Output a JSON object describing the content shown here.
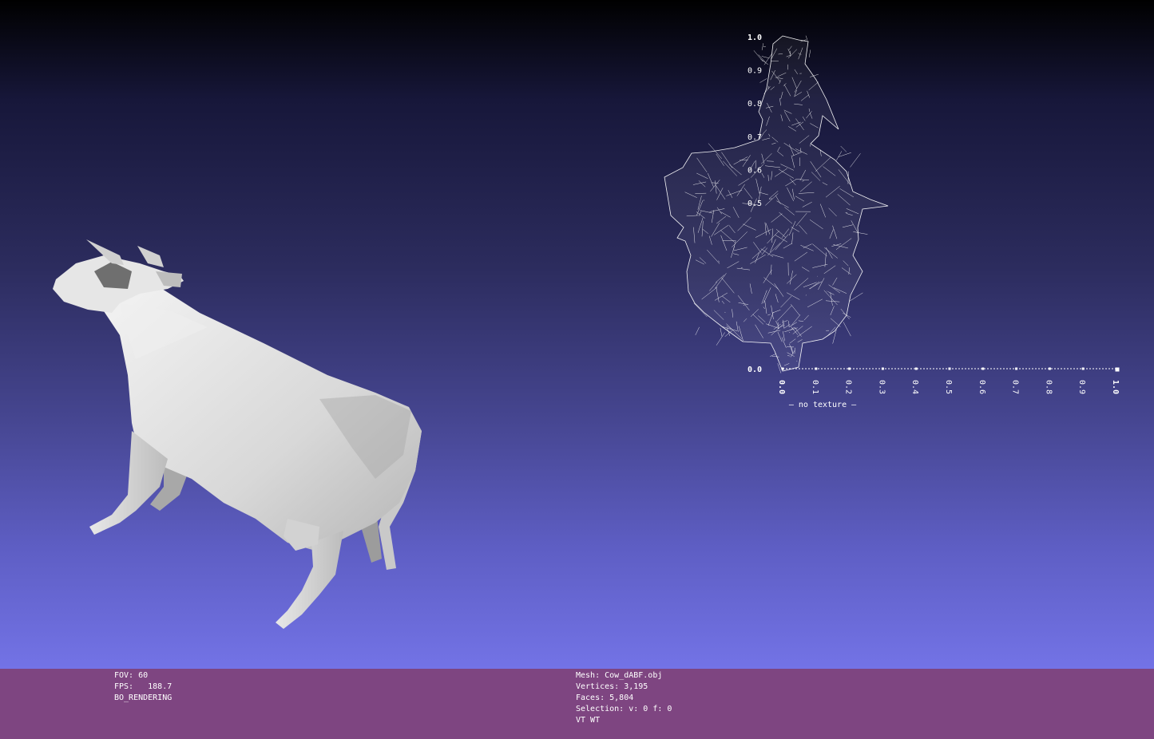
{
  "viewport": {
    "model": "cow-mesh",
    "background_top": "#000000",
    "background_bottom": "#7373e6"
  },
  "uv_plot": {
    "y_ticks": [
      "1.0",
      "0.9",
      "0.8",
      "0.7",
      "0.6",
      "0.5",
      "0.0"
    ],
    "x_ticks": [
      "0.0",
      "0.1",
      "0.2",
      "0.3",
      "0.4",
      "0.5",
      "0.6",
      "0.7",
      "0.8",
      "0.9",
      "1.0"
    ],
    "texture_label": "— no texture —"
  },
  "info_left": {
    "fov": "FOV: 60",
    "fps": "FPS:   188.7",
    "mode": "BO_RENDERING"
  },
  "info_right": {
    "mesh": "Mesh: Cow_dABF.obj",
    "vertices": "Vertices: 3,195",
    "faces": "Faces: 5,804",
    "selection": "Selection: v: 0 f: 0",
    "flags": "VT WT"
  },
  "colors": {
    "infobar": "#7e4581",
    "wire": "#ffffff"
  }
}
